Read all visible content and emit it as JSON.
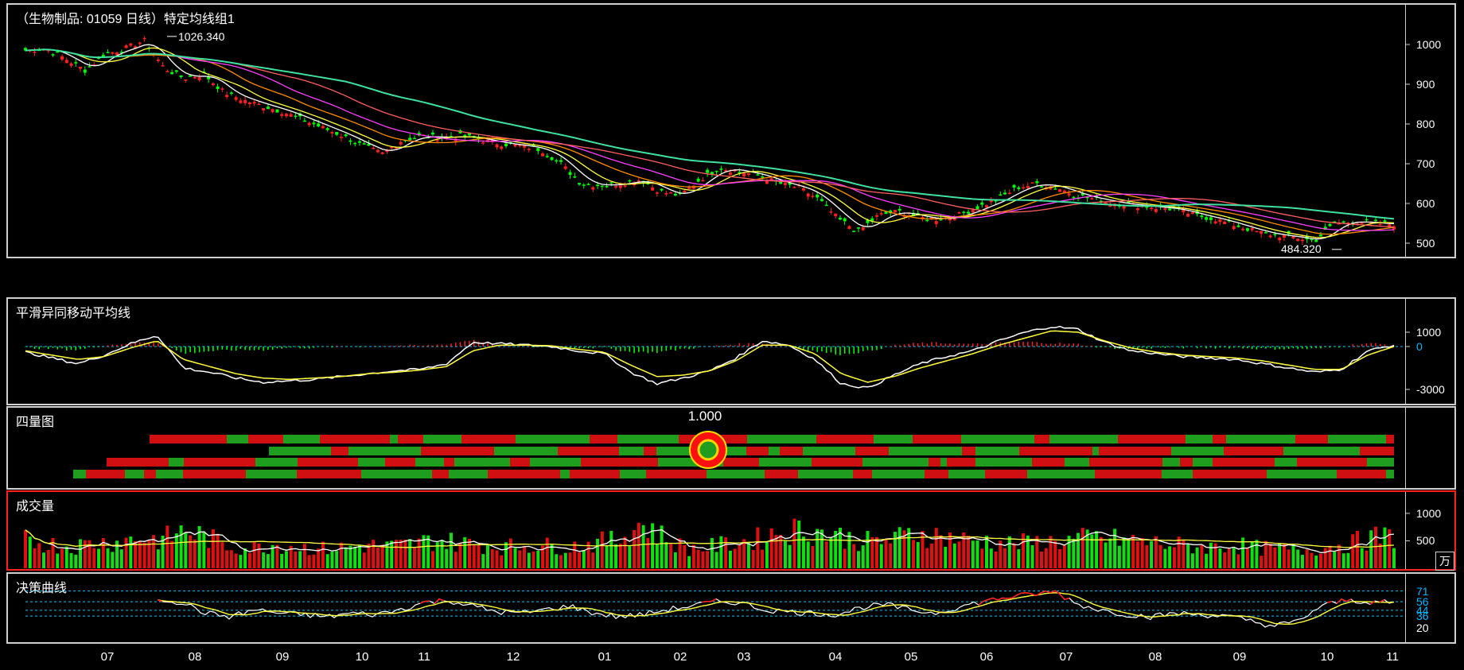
{
  "header": {
    "title": "（生物制品: 01059 日线）特定均线组1"
  },
  "price_panel": {
    "high_label": "1026.340",
    "low_label": "484.320",
    "yticks": [
      "1000",
      "900",
      "800",
      "700",
      "600",
      "500"
    ]
  },
  "macd_panel": {
    "title": "平滑异同移动平均线",
    "yticks": [
      "1000",
      "0",
      "-3000"
    ]
  },
  "quadrant_panel": {
    "title": "四量图",
    "marker_value": "1.000"
  },
  "volume_panel": {
    "title": "成交量",
    "yticks": [
      "1000",
      "500"
    ],
    "unit": "万"
  },
  "decision_panel": {
    "title": "决策曲线",
    "yticks": [
      "71",
      "56",
      "44",
      "36",
      "20"
    ]
  },
  "x_axis": {
    "months": [
      "07",
      "08",
      "09",
      "10",
      "11",
      "12",
      "01",
      "02",
      "03",
      "04",
      "05",
      "06",
      "07",
      "08",
      "09",
      "10",
      "11"
    ]
  },
  "colors": {
    "up": "#ff2020",
    "down": "#00ff00",
    "ma_long": "#40e0a0",
    "diff": "#ffffff",
    "dea": "#ffff40",
    "grid": "#00c8ff"
  },
  "chart_data": {
    "type": "line",
    "title": "（生物制品: 01059 日线）特定均线组1",
    "x_label_months": [
      "07",
      "08",
      "09",
      "10",
      "11",
      "12",
      "01",
      "02",
      "03",
      "04",
      "05",
      "06",
      "07",
      "08",
      "09",
      "10",
      "11"
    ],
    "price_close_approx": [
      985,
      990,
      965,
      935,
      975,
      990,
      1010,
      940,
      915,
      925,
      880,
      860,
      845,
      830,
      810,
      790,
      770,
      745,
      725,
      760,
      770,
      765,
      770,
      760,
      750,
      745,
      735,
      700,
      650,
      645,
      650,
      660,
      630,
      620,
      660,
      690,
      680,
      670,
      650,
      640,
      610,
      560,
      530,
      570,
      580,
      565,
      560,
      570,
      590,
      610,
      640,
      650,
      640,
      620,
      610,
      600,
      595,
      590,
      585,
      570,
      560,
      545,
      530,
      520,
      515,
      505,
      550,
      555,
      550,
      548
    ],
    "ylim": [
      480,
      1040
    ],
    "high": 1026.34,
    "low": 484.32,
    "macd_dif_approx": [
      -400,
      -800,
      -1200,
      -600,
      200,
      800,
      -1500,
      -1800,
      -2200,
      -2500,
      -2400,
      -2300,
      -2100,
      -1900,
      -1700,
      -1600,
      -1200,
      300,
      200,
      100,
      0,
      -300,
      -500,
      -1800,
      -2600,
      -2200,
      -1700,
      -800,
      400,
      100,
      -900,
      -2600,
      -2900,
      -2000,
      -1200,
      -700,
      -300,
      400,
      1000,
      1400,
      1200,
      300,
      -300,
      -500,
      -700,
      -800,
      -900,
      -1200,
      -1500,
      -1800,
      -1600,
      -300,
      100
    ],
    "macd_dea_approx": [
      -300,
      -600,
      -900,
      -700,
      -100,
      400,
      -900,
      -1400,
      -1900,
      -2200,
      -2300,
      -2200,
      -2100,
      -1900,
      -1800,
      -1650,
      -1400,
      -300,
      100,
      100,
      50,
      -200,
      -400,
      -1300,
      -2100,
      -2000,
      -1700,
      -1000,
      100,
      100,
      -500,
      -1900,
      -2500,
      -2100,
      -1500,
      -1000,
      -500,
      100,
      600,
      1100,
      1000,
      400,
      -100,
      -400,
      -600,
      -700,
      -800,
      -1000,
      -1300,
      -1600,
      -1600,
      -600,
      0
    ],
    "volume_approx": [
      550,
      480,
      430,
      500,
      520,
      600,
      560,
      750,
      600,
      420,
      400,
      480,
      420,
      380,
      410,
      450,
      430,
      480,
      560,
      500,
      470,
      420,
      460,
      440,
      430,
      500,
      560,
      900,
      600,
      380,
      420,
      500,
      560,
      720,
      760,
      700,
      600,
      520,
      560,
      700,
      640,
      560,
      540,
      480,
      500,
      520,
      560,
      600,
      560,
      520,
      480,
      440,
      420,
      460,
      400,
      380,
      360,
      420,
      480,
      600,
      620
    ],
    "decision_approx": [
      60,
      55,
      40,
      35,
      45,
      40,
      38,
      35,
      40,
      38,
      45,
      55,
      58,
      50,
      42,
      40,
      45,
      50,
      40,
      35,
      38,
      45,
      50,
      56,
      55,
      45,
      42,
      40,
      38,
      48,
      52,
      45,
      40,
      48,
      56,
      62,
      66,
      70,
      52,
      44,
      38,
      35,
      40,
      38,
      36,
      30,
      22,
      28,
      50,
      58,
      56,
      54
    ],
    "decision_levels": [
      71,
      56,
      44,
      36,
      20
    ]
  }
}
